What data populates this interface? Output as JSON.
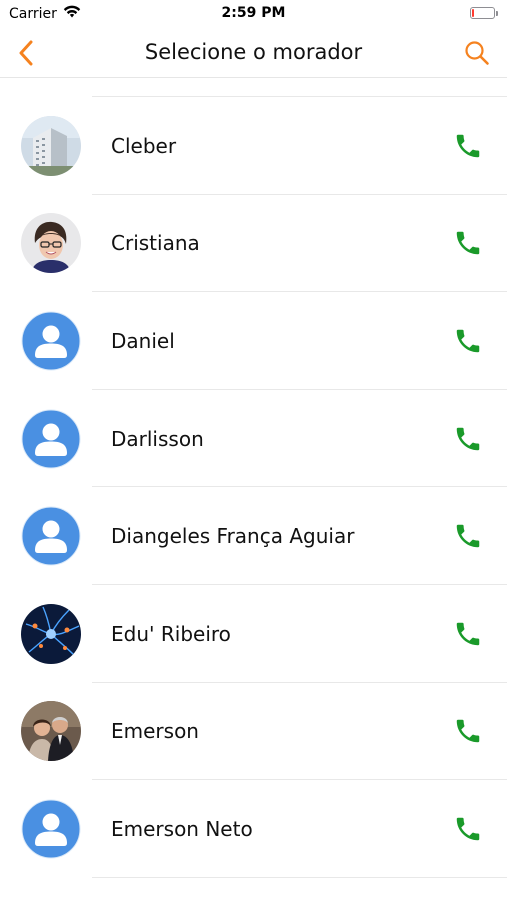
{
  "status_bar": {
    "carrier": "Carrier",
    "time": "2:59 PM",
    "battery_level": 0.1
  },
  "nav": {
    "title": "Selecione o morador"
  },
  "colors": {
    "accent": "#f5821f",
    "call_green": "#1a9a2a",
    "avatar_blue": "#4a90e2"
  },
  "residents": [
    {
      "name": "Cleber",
      "avatar": "photo-building"
    },
    {
      "name": "Cristiana",
      "avatar": "photo-person"
    },
    {
      "name": "Daniel",
      "avatar": "default-user-icon"
    },
    {
      "name": "Darlisson",
      "avatar": "default-user-icon"
    },
    {
      "name": "Diangeles França Aguiar",
      "avatar": "default-user-icon"
    },
    {
      "name": "Edu' Ribeiro",
      "avatar": "photo-neurons"
    },
    {
      "name": "Emerson",
      "avatar": "photo-people"
    },
    {
      "name": "Emerson Neto",
      "avatar": "default-user-icon"
    }
  ]
}
